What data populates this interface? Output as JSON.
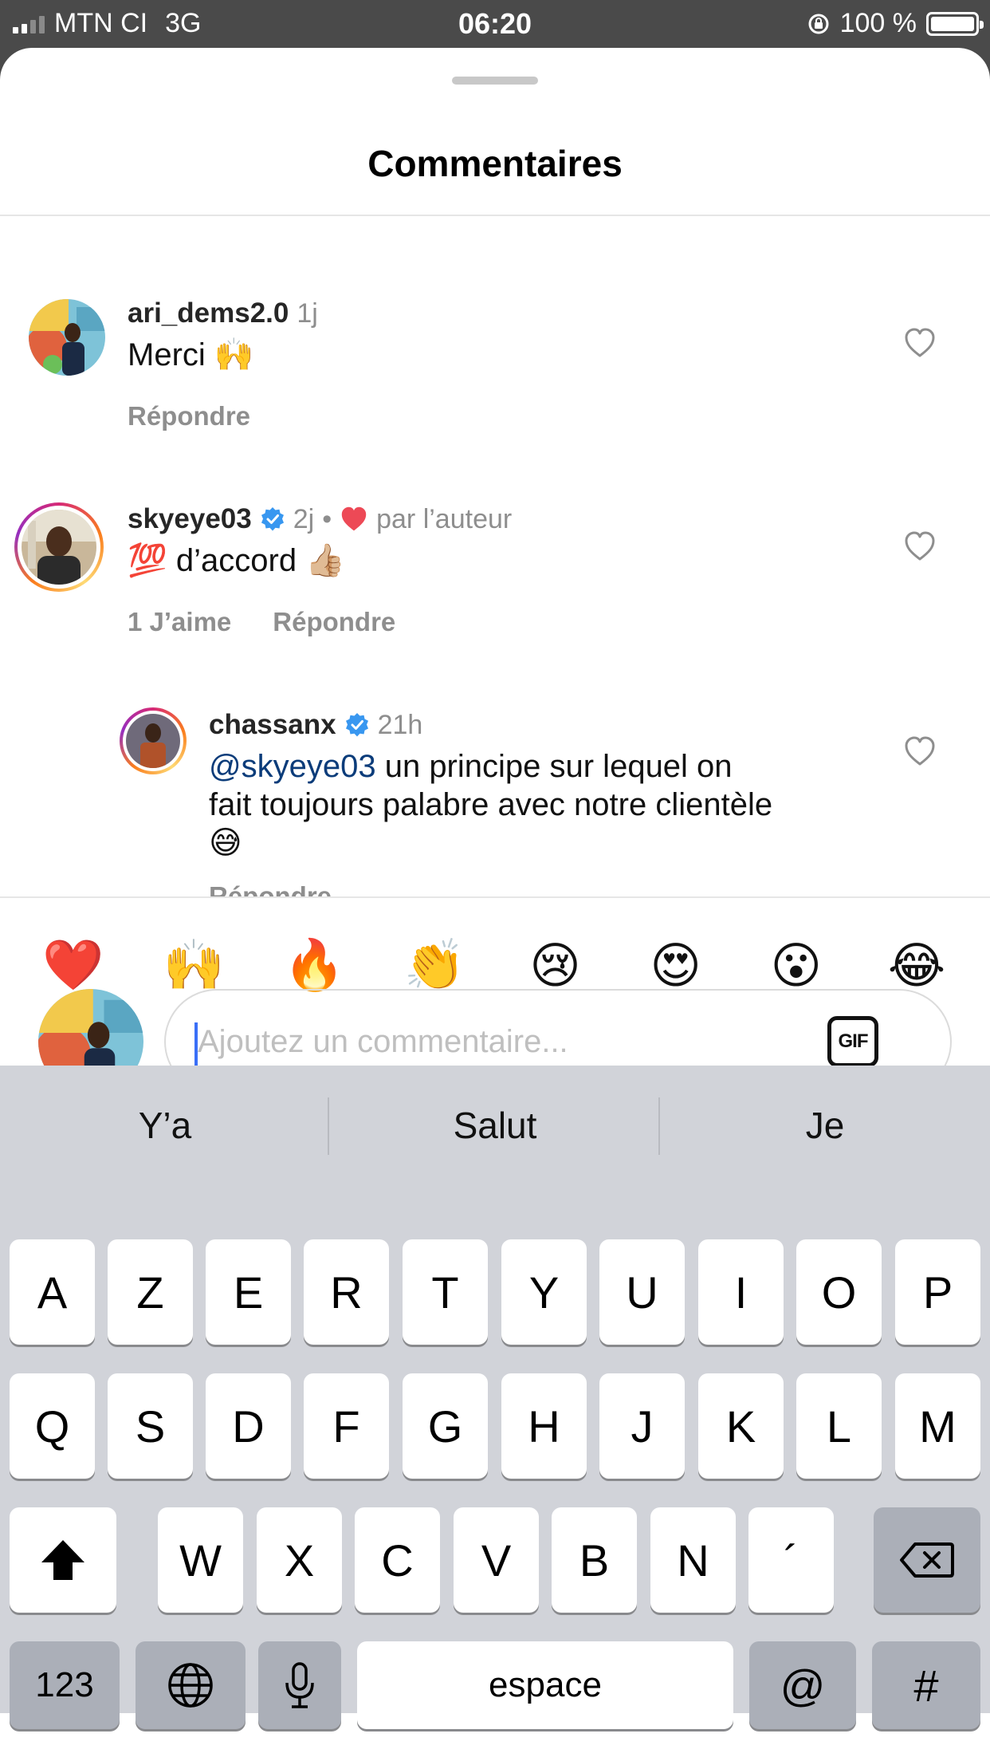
{
  "status_bar": {
    "carrier": "MTN CI",
    "network": "3G",
    "time": "06:20",
    "battery": "100 %"
  },
  "sheet": {
    "title": "Commentaires"
  },
  "comments": [
    {
      "username": "ari_dems2.0",
      "time": "1j",
      "text": "Merci 🙌",
      "reply": "Répondre"
    },
    {
      "username": "skyeye03",
      "time": "2j",
      "separator": "•",
      "liked_by_author": "par l’auteur",
      "text": "💯 d’accord 👍🏼",
      "likes": "1 J’aime",
      "reply": "Répondre"
    },
    {
      "username": "chassanx",
      "time": "21h",
      "mention": "@skyeye03",
      "text_line1": " un principe sur lequel on",
      "text_line2": "fait toujours palabre avec notre clientèle",
      "text_line3": "😅",
      "reply": "Répondre"
    }
  ],
  "emoji_bar": [
    "❤️",
    "🙌",
    "🔥",
    "👏",
    "😢",
    "😍",
    "😮",
    "😂"
  ],
  "composer": {
    "placeholder": "Ajoutez un commentaire...",
    "gif_label": "GIF"
  },
  "keyboard": {
    "suggestions": [
      "Y’a",
      "Salut",
      "Je"
    ],
    "row1": [
      "A",
      "Z",
      "E",
      "R",
      "T",
      "Y",
      "U",
      "I",
      "O",
      "P"
    ],
    "row2": [
      "Q",
      "S",
      "D",
      "F",
      "G",
      "H",
      "J",
      "K",
      "L",
      "M"
    ],
    "row3": [
      "W",
      "X",
      "C",
      "V",
      "B",
      "N",
      "´"
    ],
    "numbers_key": "123",
    "space_key": "espace",
    "at_key": "@",
    "hash_key": "#"
  },
  "colors": {
    "accent_blue": "#3897f0",
    "mention": "#0b3c7a",
    "like_red": "#ed4956",
    "muted": "#8e8e8e"
  }
}
